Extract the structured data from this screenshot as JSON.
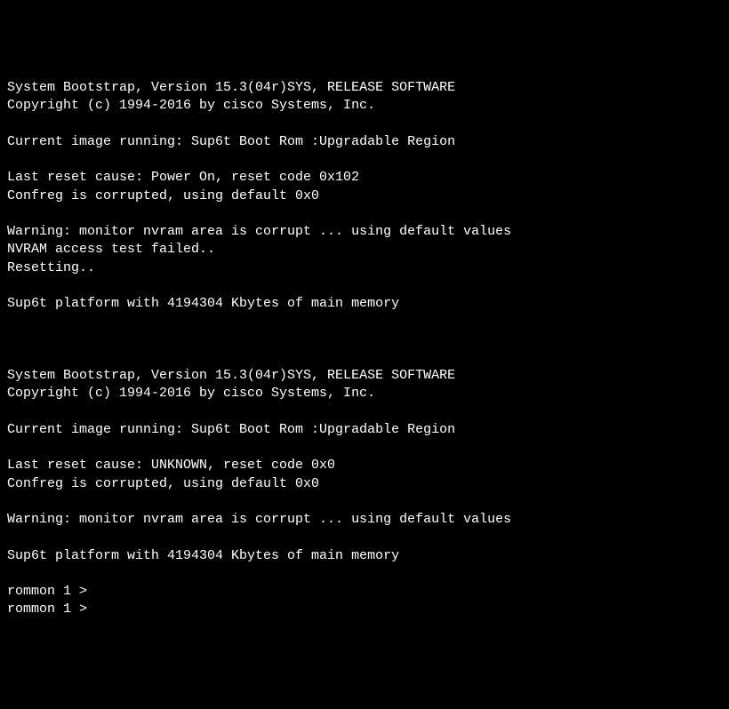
{
  "terminal": {
    "lines": [
      "System Bootstrap, Version 15.3(04r)SYS, RELEASE SOFTWARE",
      "Copyright (c) 1994-2016 by cisco Systems, Inc.",
      "",
      "Current image running: Sup6t Boot Rom :Upgradable Region",
      "",
      "Last reset cause: Power On, reset code 0x102",
      "Confreg is corrupted, using default 0x0",
      "",
      "Warning: monitor nvram area is corrupt ... using default values",
      "NVRAM access test failed..",
      "Resetting..",
      "",
      "Sup6t platform with 4194304 Kbytes of main memory",
      "",
      "",
      "",
      "System Bootstrap, Version 15.3(04r)SYS, RELEASE SOFTWARE",
      "Copyright (c) 1994-2016 by cisco Systems, Inc.",
      "",
      "Current image running: Sup6t Boot Rom :Upgradable Region",
      "",
      "Last reset cause: UNKNOWN, reset code 0x0",
      "Confreg is corrupted, using default 0x0",
      "",
      "Warning: monitor nvram area is corrupt ... using default values",
      "",
      "Sup6t platform with 4194304 Kbytes of main memory",
      "",
      "rommon 1 >",
      "rommon 1 >"
    ]
  }
}
